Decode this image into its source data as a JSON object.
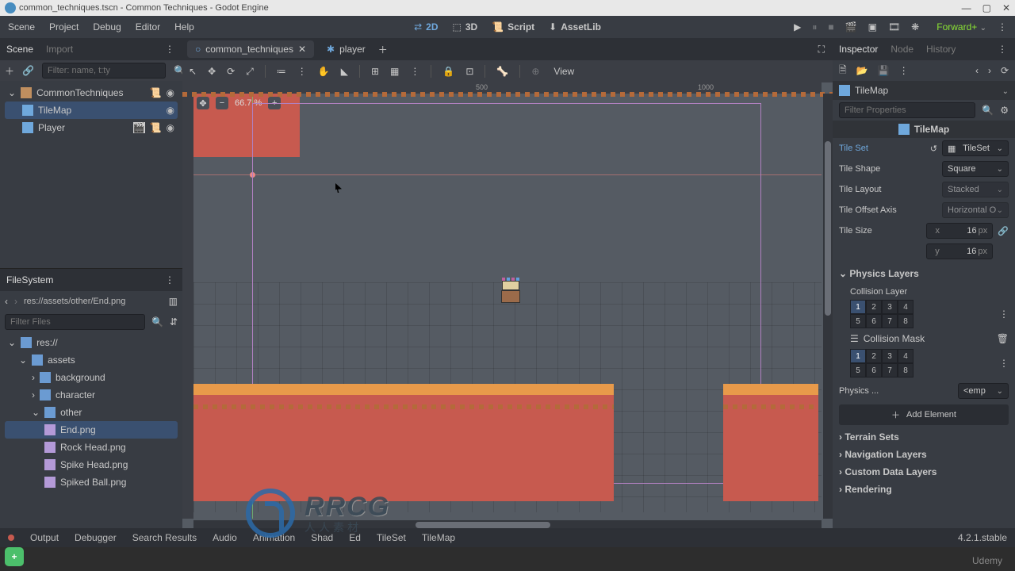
{
  "title": "common_techniques.tscn - Common Techniques - Godot Engine",
  "menubar": {
    "scene": "Scene",
    "project": "Project",
    "debug": "Debug",
    "editor": "Editor",
    "help": "Help",
    "mode2d": "2D",
    "mode3d": "3D",
    "script": "Script",
    "assetlib": "AssetLib",
    "forward": "Forward+"
  },
  "scene_panel": {
    "tab_scene": "Scene",
    "tab_import": "Import",
    "filter_ph": "Filter: name, t:ty",
    "root": "CommonTechniques",
    "tilemap": "TileMap",
    "player": "Player"
  },
  "fs_panel": {
    "title": "FileSystem",
    "path": "res://assets/other/End.png",
    "filter_ph": "Filter Files",
    "res": "res://",
    "assets": "assets",
    "bg": "background",
    "char": "character",
    "other": "other",
    "f1": "End.png",
    "f2": "Rock Head.png",
    "f3": "Spike Head.png",
    "f4": "Spiked Ball.png"
  },
  "tabs": {
    "t1": "common_techniques",
    "t2": "player"
  },
  "zoom": "66.7 %",
  "ruler": {
    "r500": "500",
    "r1000": "1000"
  },
  "toolbar_view": "View",
  "inspector": {
    "tab_inspector": "Inspector",
    "tab_node": "Node",
    "tab_history": "History",
    "obj": "TileMap",
    "filter_ph": "Filter Properties",
    "class": "TileMap",
    "tileset_lbl": "Tile Set",
    "tileset_val": "TileSet",
    "shape_lbl": "Tile Shape",
    "shape_val": "Square",
    "layout_lbl": "Tile Layout",
    "layout_val": "Stacked",
    "offset_lbl": "Tile Offset Axis",
    "offset_val": "Horizontal O",
    "size_lbl": "Tile Size",
    "size_x": "16",
    "size_y": "16",
    "px": "px",
    "phys": "Physics Layers",
    "coll_layer": "Collision Layer",
    "coll_mask": "Collision Mask",
    "l1": "1",
    "l2": "2",
    "l3": "3",
    "l4": "4",
    "l5": "5",
    "l6": "6",
    "l7": "7",
    "l8": "8",
    "physmat": "Physics ...",
    "physmat_val": "<emp",
    "addel": "Add Element",
    "terrain": "Terrain Sets",
    "nav": "Navigation Layers",
    "custom": "Custom Data Layers",
    "render": "Rendering"
  },
  "bottom": {
    "output": "Output",
    "debugger": "Debugger",
    "search": "Search Results",
    "audio": "Audio",
    "anim": "Animation",
    "shad": "Shad",
    "ed": "Ed",
    "tileset": "TileSet",
    "tilemap": "TileMap",
    "ver": "4.2.1.stable"
  },
  "watermark": {
    "big": "RRCG",
    "sub": "人人素材"
  },
  "udemy": "Udemy"
}
